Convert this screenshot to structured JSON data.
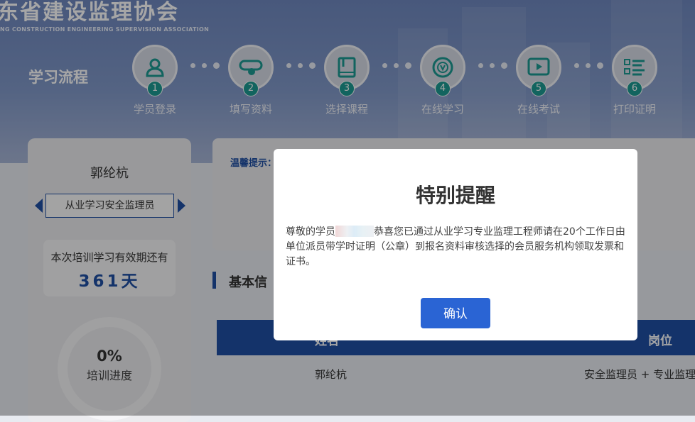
{
  "header": {
    "org_title": "东省建设监理协会",
    "org_subtitle": "NG CONSTRUCTION ENGINEERING SUPERVISION ASSOCIATION",
    "flow_title": "学习流程"
  },
  "steps": [
    {
      "num": "1",
      "label": "学员登录",
      "icon": "user-icon"
    },
    {
      "num": "2",
      "label": "填写资料",
      "icon": "edit-form-icon"
    },
    {
      "num": "3",
      "label": "选择课程",
      "icon": "book-icon"
    },
    {
      "num": "4",
      "label": "在线学习",
      "icon": "online-study-icon"
    },
    {
      "num": "5",
      "label": "在线考试",
      "icon": "video-exam-icon"
    },
    {
      "num": "6",
      "label": "打印证明",
      "icon": "list-print-icon"
    }
  ],
  "profile": {
    "name": "郭纶杭",
    "role": "从业学习安全监理员",
    "validity_label": "本次培训学习有效期还有",
    "validity_days": "361天",
    "progress_percent": "0%",
    "progress_fraction": 0,
    "progress_label": "培训进度"
  },
  "notice": {
    "tip_label": "温馨提示："
  },
  "basic_info": {
    "title": "基本信",
    "columns": [
      "姓名",
      "岗位"
    ],
    "row": {
      "name": "郭纶杭",
      "position": "安全监理员 + 专业监理"
    }
  },
  "modal": {
    "title": "特别提醒",
    "body_before": "尊敬的学员",
    "body_after": "恭喜您已通过从业学习专业监理工程师请在20个工作日由单位派员带学时证明（公章）到报名资料审核选择的会员服务机构领取发票和证书。",
    "confirm_label": "确认"
  },
  "colors": {
    "accent": "#1f4fa3",
    "teal": "#1c9a92",
    "button": "#2a64d4"
  }
}
